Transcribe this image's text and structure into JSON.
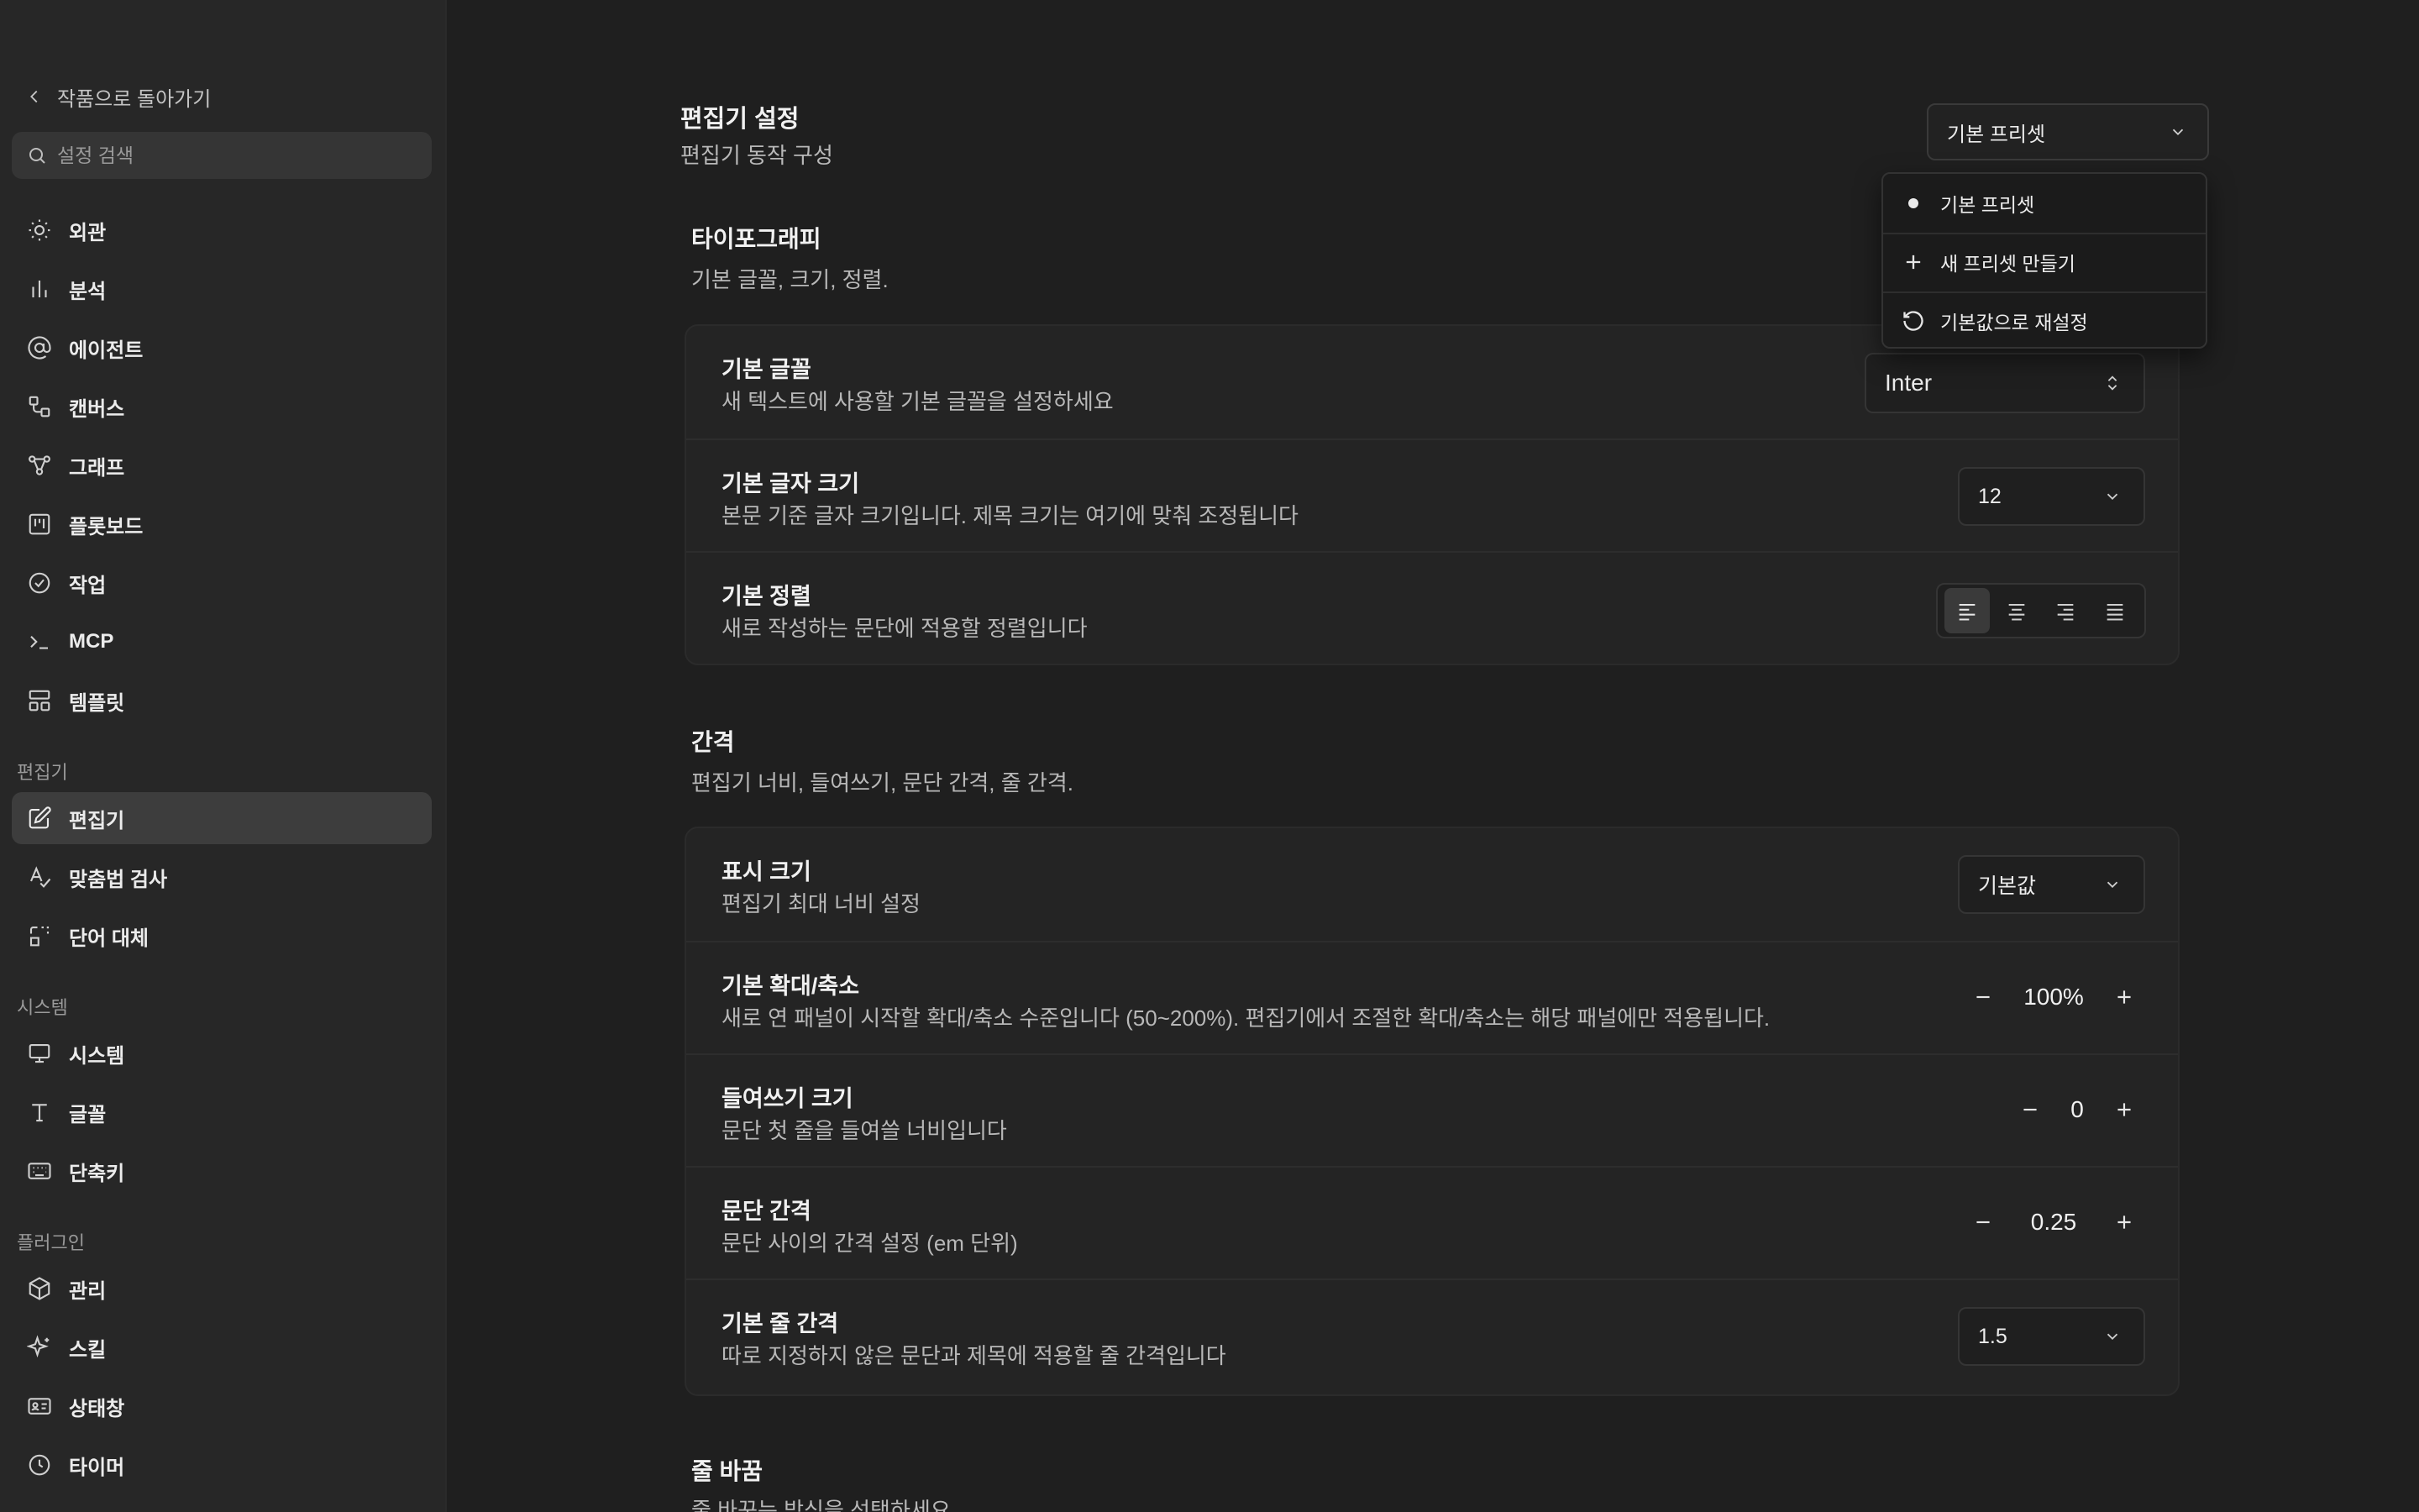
{
  "sidebar": {
    "back_label": "작품으로 돌아가기",
    "search_placeholder": "설정 검색",
    "items_top": [
      {
        "label": "외관",
        "icon": "sun-icon"
      },
      {
        "label": "분석",
        "icon": "bar-chart-icon"
      },
      {
        "label": "에이전트",
        "icon": "at-sign-icon"
      },
      {
        "label": "캔버스",
        "icon": "shapes-icon"
      },
      {
        "label": "그래프",
        "icon": "graph-icon"
      },
      {
        "label": "플롯보드",
        "icon": "kanban-icon"
      },
      {
        "label": "작업",
        "icon": "check-circle-icon"
      },
      {
        "label": "MCP",
        "icon": "terminal-icon"
      },
      {
        "label": "템플릿",
        "icon": "layout-icon"
      }
    ],
    "section_editor": "편집기",
    "items_editor": [
      {
        "label": "편집기",
        "icon": "edit-icon",
        "active": true
      },
      {
        "label": "맞춤법 검사",
        "icon": "spellcheck-icon"
      },
      {
        "label": "단어 대체",
        "icon": "replace-icon"
      }
    ],
    "section_system": "시스템",
    "items_system": [
      {
        "label": "시스템",
        "icon": "monitor-icon"
      },
      {
        "label": "글꼴",
        "icon": "type-icon"
      },
      {
        "label": "단축키",
        "icon": "keyboard-icon"
      }
    ],
    "section_plugins": "플러그인",
    "items_plugins": [
      {
        "label": "관리",
        "icon": "package-icon"
      },
      {
        "label": "스킬",
        "icon": "sparkles-icon"
      },
      {
        "label": "상태창",
        "icon": "id-card-icon"
      },
      {
        "label": "타이머",
        "icon": "clock-icon"
      }
    ]
  },
  "header": {
    "title": "편집기 설정",
    "subtitle": "편집기 동작 구성",
    "preset_value": "기본 프리셋"
  },
  "preset_menu": {
    "items": [
      {
        "label": "기본 프리셋",
        "icon": "bullet-icon"
      },
      {
        "label": "새 프리셋 만들기",
        "icon": "plus-icon"
      },
      {
        "label": "기본값으로 재설정",
        "icon": "reset-icon"
      }
    ]
  },
  "typography": {
    "title": "타이포그래피",
    "desc": "기본 글꼴, 크기, 정렬.",
    "font": {
      "title": "기본 글꼴",
      "desc": "새 텍스트에 사용할 기본 글꼴을 설정하세요",
      "value": "Inter"
    },
    "size": {
      "title": "기본 글자 크기",
      "desc": "본문 기준 글자 크기입니다. 제목 크기는 여기에 맞춰 조정됩니다",
      "value": "12"
    },
    "align": {
      "title": "기본 정렬",
      "desc": "새로 작성하는 문단에 적용할 정렬입니다",
      "selected": "left"
    }
  },
  "spacing": {
    "title": "간격",
    "desc": "편집기 너비, 들여쓰기, 문단 간격, 줄 간격.",
    "display": {
      "title": "표시 크기",
      "desc": "편집기 최대 너비 설정",
      "value": "기본값"
    },
    "zoom": {
      "title": "기본 확대/축소",
      "desc": "새로 연 패널이 시작할 확대/축소 수준입니다 (50~200%). 편집기에서 조절한 확대/축소는 해당 패널에만 적용됩니다.",
      "value": "100%"
    },
    "indent": {
      "title": "들여쓰기 크기",
      "desc": "문단 첫 줄을 들여쓸 너비입니다",
      "value": "0"
    },
    "paragraph": {
      "title": "문단 간격",
      "desc": "문단 사이의 간격 설정 (em 단위)",
      "value": "0.25"
    },
    "line": {
      "title": "기본 줄 간격",
      "desc": "따로 지정하지 않은 문단과 제목에 적용할 줄 간격입니다",
      "value": "1.5"
    }
  },
  "wrap": {
    "title": "줄 바꿈",
    "desc": "줄 바꾸는 방식을 선택하세요."
  }
}
